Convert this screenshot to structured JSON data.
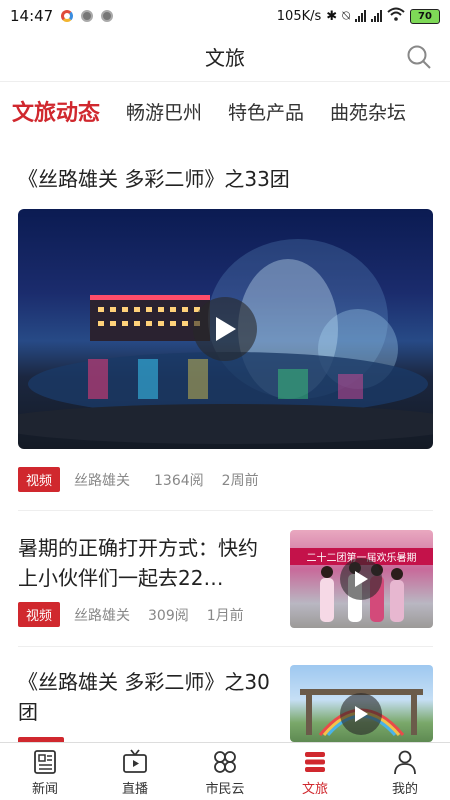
{
  "status_bar": {
    "time": "14:47",
    "network_speed": "105K/s",
    "battery": "70"
  },
  "header": {
    "title": "文旅",
    "search_icon": "search-icon"
  },
  "tabs": [
    {
      "label": "文旅动态",
      "active": true
    },
    {
      "label": "畅游巴州",
      "active": false
    },
    {
      "label": "特色产品",
      "active": false
    },
    {
      "label": "曲苑杂坛",
      "active": false
    }
  ],
  "feed": {
    "featured": {
      "title": "《丝路雄关 多彩二师》之33团",
      "badge": "视频",
      "source": "丝路雄关",
      "views": "1364阅",
      "time": "2周前"
    },
    "items": [
      {
        "title": "暑期的正确打开方式：快约上小伙伴们一起去22…",
        "badge": "视频",
        "source": "丝路雄关",
        "views": "309阅",
        "time": "1月前",
        "thumb_caption": "二十二团第一届欢乐暑期"
      },
      {
        "title": "《丝路雄关 多彩二师》之30团",
        "badge": "视频"
      }
    ]
  },
  "bottom_nav": [
    {
      "label": "新闻",
      "icon": "news-icon",
      "active": false
    },
    {
      "label": "直播",
      "icon": "tv-icon",
      "active": false
    },
    {
      "label": "市民云",
      "icon": "clover-icon",
      "active": false
    },
    {
      "label": "文旅",
      "icon": "culture-tourism-icon",
      "active": true
    },
    {
      "label": "我的",
      "icon": "user-icon",
      "active": false
    }
  ],
  "colors": {
    "accent": "#d0282e",
    "text": "#222222",
    "muted": "#888888"
  }
}
